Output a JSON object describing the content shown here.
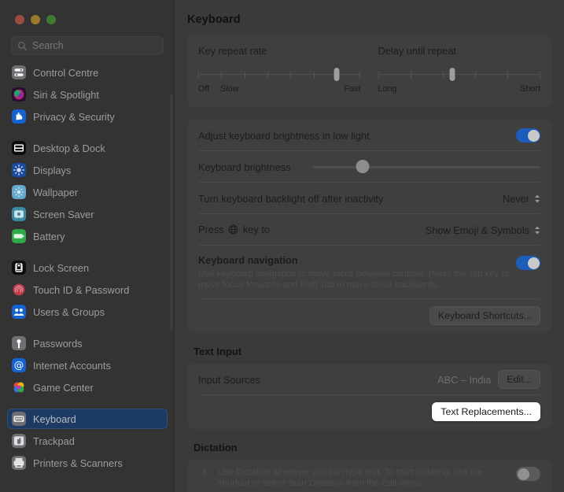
{
  "window": {
    "traffic_lights": [
      "close",
      "minimize",
      "zoom"
    ],
    "search": {
      "placeholder": "Search",
      "value": "",
      "icon": "search-icon"
    }
  },
  "sidebar": {
    "groups": [
      {
        "items": [
          {
            "label": "Control Centre",
            "icon": "control-centre-icon",
            "selected": false
          },
          {
            "label": "Siri & Spotlight",
            "icon": "siri-spotlight-icon",
            "selected": false
          },
          {
            "label": "Privacy & Security",
            "icon": "privacy-security-icon",
            "selected": false
          }
        ]
      },
      {
        "items": [
          {
            "label": "Desktop & Dock",
            "icon": "desktop-dock-icon",
            "selected": false
          },
          {
            "label": "Displays",
            "icon": "displays-icon",
            "selected": false
          },
          {
            "label": "Wallpaper",
            "icon": "wallpaper-icon",
            "selected": false
          },
          {
            "label": "Screen Saver",
            "icon": "screen-saver-icon",
            "selected": false
          },
          {
            "label": "Battery",
            "icon": "battery-icon",
            "selected": false
          }
        ]
      },
      {
        "items": [
          {
            "label": "Lock Screen",
            "icon": "lock-screen-icon",
            "selected": false
          },
          {
            "label": "Touch ID & Password",
            "icon": "touch-id-icon",
            "selected": false
          },
          {
            "label": "Users & Groups",
            "icon": "users-groups-icon",
            "selected": false
          }
        ]
      },
      {
        "items": [
          {
            "label": "Passwords",
            "icon": "passwords-icon",
            "selected": false
          },
          {
            "label": "Internet Accounts",
            "icon": "internet-accounts-icon",
            "selected": false
          },
          {
            "label": "Game Center",
            "icon": "game-center-icon",
            "selected": false
          }
        ]
      },
      {
        "items": [
          {
            "label": "Keyboard",
            "icon": "keyboard-icon",
            "selected": true
          },
          {
            "label": "Trackpad",
            "icon": "trackpad-icon",
            "selected": false
          },
          {
            "label": "Printers & Scanners",
            "icon": "printers-icon",
            "selected": false
          }
        ]
      }
    ]
  },
  "main": {
    "title": "Keyboard",
    "sliders": {
      "key_repeat": {
        "label": "Key repeat rate",
        "min_label": "Off",
        "second_label": "Slow",
        "max_label": "Fast",
        "ticks": 8,
        "value_index": 7,
        "value_percent": 85
      },
      "delay_until_repeat": {
        "label": "Delay until repeat",
        "min_label": "Long",
        "max_label": "Short",
        "ticks": 6,
        "value_index": 4,
        "value_percent": 46
      }
    },
    "brightness_card": {
      "adjust_low_light": {
        "label": "Adjust keyboard brightness in low light",
        "state": "on"
      },
      "keyboard_brightness": {
        "label": "Keyboard brightness",
        "value_percent": 22
      },
      "backlight_off": {
        "label": "Turn keyboard backlight off after inactivity",
        "value": "Never"
      },
      "globe_key": {
        "label_before": "Press",
        "label_after": "key to",
        "icon": "globe-icon",
        "value": "Show Emoji & Symbols"
      },
      "keyboard_navigation": {
        "label": "Keyboard navigation",
        "state": "on",
        "description": "Use keyboard navigation to move focus between controls. Press the Tab key to move focus forwards and Shift Tab to move focus backwards."
      },
      "shortcuts_button": "Keyboard Shortcuts..."
    },
    "text_input": {
      "heading": "Text Input",
      "input_sources": {
        "label": "Input Sources",
        "value": "ABC – India",
        "edit_button": "Edit..."
      },
      "text_replacements_button": "Text Replacements...",
      "highlighted": true
    },
    "dictation": {
      "heading": "Dictation",
      "description": "Use Dictation wherever you can type text. To start dictating, use the shortcut or select Start Dictation from the Edit menu.",
      "icon": "microphone-icon",
      "state": "off"
    }
  },
  "colors": {
    "accent_blue": "#1c5dba",
    "selected_row": "#1d3a63",
    "sidebar_bg": "#333333",
    "content_bg": "#3a3a3a",
    "card_bg": "#3f3f3f",
    "highlight_white": "#ffffff"
  }
}
